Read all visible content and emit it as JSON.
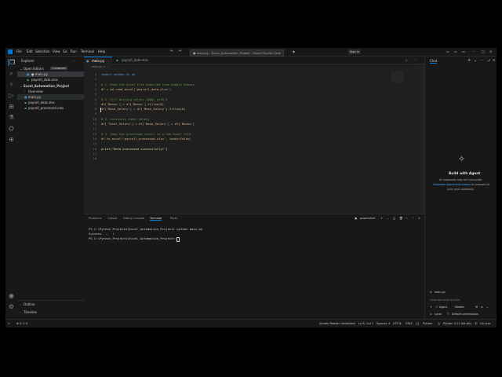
{
  "titlebar": {
    "menu": [
      "File",
      "Edit",
      "Selection",
      "View",
      "Go",
      "Run",
      "Terminal",
      "Help"
    ],
    "command_center": "● main.py - Excel_Automation_Project - Visual Studio Code",
    "sign_in": "Sign in"
  },
  "sidebar": {
    "title": "Explorer",
    "open_editors_label": "Open Editors",
    "open_editors_badge": "1 unsaved",
    "open_editors": [
      "● main.py",
      "payroll_data.xlsx"
    ],
    "project_label": "Excel_Automation_Project",
    "files": [
      "Overview",
      "main.py",
      "payroll_data.xlsx",
      "payroll_processed.xlsx"
    ],
    "outline_label": "Outline",
    "timeline_label": "Timeline"
  },
  "tabs": [
    {
      "label": "main.py",
      "active": true,
      "icon": "python-icon"
    },
    {
      "label": "payroll_data.xlsx",
      "active": false,
      "icon": "excel-icon"
    }
  ],
  "editor": {
    "breadcrumb": "main.py > ...",
    "line_numbers": [
      "1",
      "2",
      "3",
      "4",
      "5",
      "6",
      "7",
      "8",
      "9",
      "10",
      "11",
      "12",
      "13",
      "14",
      "15",
      "16",
      "17",
      "18"
    ],
    "lines": [
      "import pandas as pd",
      "",
      "# 1. Read the Excel file exported from Google Sheets",
      "df = pd.read_excel('payroll_data.xlsx')",
      "",
      "# 2. Fill missing values (NaN) with 0",
      "df['Bonus'] = df['Bonus'].fillna(0)",
      "df['Base_Salary'] = df['Base_Salary'].fillna(0)",
      "",
      "# 3. Calculate total salary",
      "df['Total_Salary'] = df['Base_Salary'] + df['Bonus']",
      "",
      "# 4. Save the processed result to a new Excel file",
      "df.to_excel('payroll_processed.xlsx', index=False)",
      "",
      "print(\"Data processed successfully!\")",
      "",
      ""
    ]
  },
  "panel": {
    "tabs": [
      "Problems",
      "Output",
      "Debug Console",
      "Terminal",
      "Ports"
    ],
    "active_tab": "Terminal",
    "shell_label": "powershell",
    "terminal_lines": [
      "PS C:\\Python_Projects\\Excel_Automation_Project> python main.py",
      "Success....  !",
      "PS C:\\Python_Projects\\Excel_Automation_Project> "
    ]
  },
  "chat": {
    "title": "Chat",
    "heading": "Build with Agent",
    "desc1": "AI responses may be inaccurate.",
    "desc2_link": "Generate Agent Instructions",
    "desc2_rest": " to onboard AI",
    "desc3": "onto your codebase.",
    "context_chip": "main.py",
    "input_placeholder": "Describe what to build",
    "mode_label": "Agent",
    "model_label": "Models",
    "local_label": "Local",
    "permissions_label": "Default permissions"
  },
  "status": {
    "problems": "⊗ 0 ⚠ 0",
    "screen_reader": "Screen Reader Optimized",
    "position": "Ln 8, Col 1",
    "spaces": "Spaces: 4",
    "encoding": "UTF-8",
    "eol": "CRLF",
    "language": "Python",
    "interpreter": "Python 3.12 (64-bit)",
    "golive": "Go Live"
  },
  "colors": {
    "accent": "#0078d4",
    "keyword": "#569cd6",
    "string": "#ce9178",
    "comment": "#6a9955",
    "function": "#dcdcaa"
  }
}
